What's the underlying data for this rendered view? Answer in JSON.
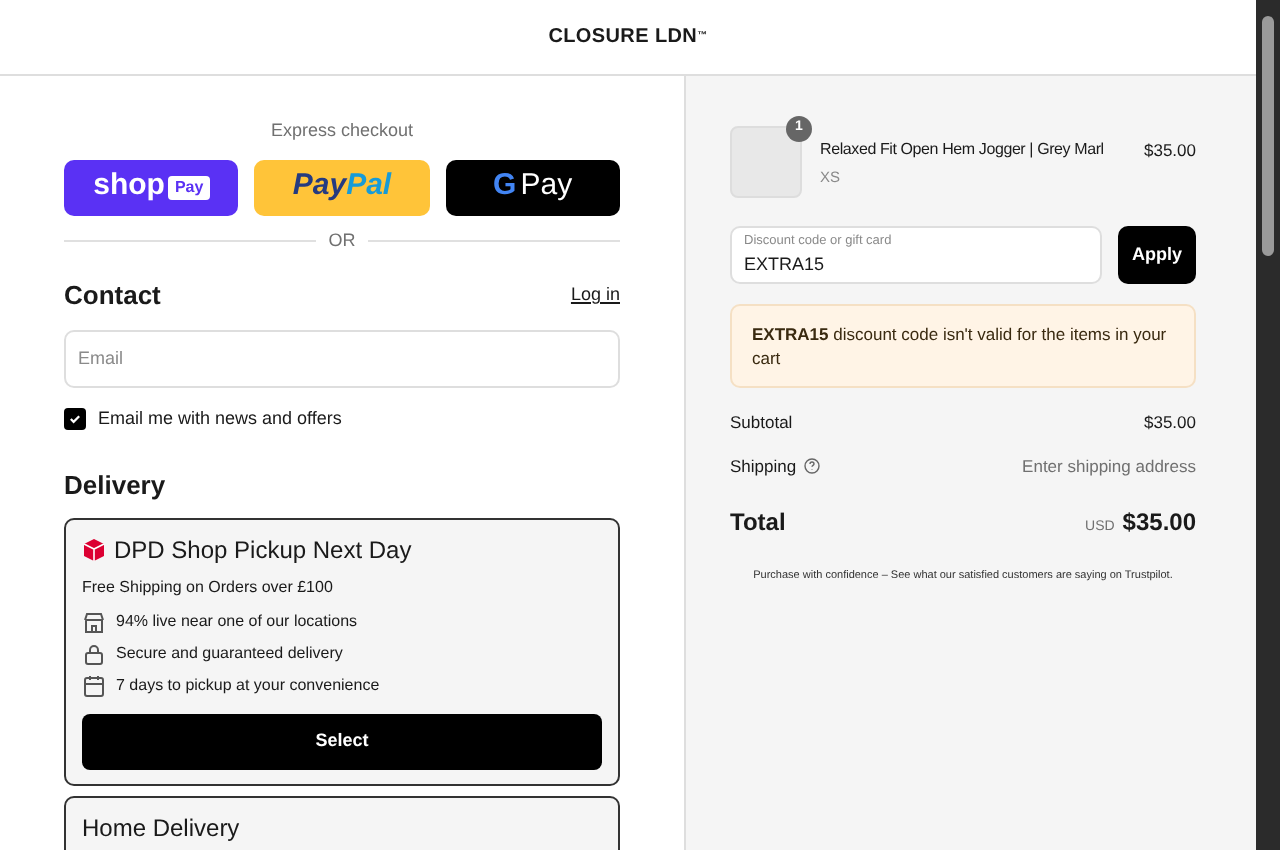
{
  "header": {
    "brand": "CLOSURE LDN",
    "brand_mark": "™"
  },
  "express": {
    "title": "Express checkout",
    "buttons": [
      {
        "kind": "shop",
        "label": "shop",
        "badge": "Pay"
      },
      {
        "kind": "paypal",
        "label": "Pay",
        "label_2": "Pal"
      },
      {
        "kind": "gpay",
        "letter": "G",
        "label": "Pay"
      }
    ],
    "divider": "OR"
  },
  "contact": {
    "title": "Contact",
    "login": "Log in",
    "email": {
      "placeholder": "Email"
    },
    "newsletter": {
      "label": "Email me with news and offers",
      "checked": true
    }
  },
  "delivery": {
    "title": "Delivery",
    "options": [
      {
        "name": "DPD Shop Pickup Next Day",
        "note": "Free Shipping on Orders over £100",
        "features": [
          {
            "kind": "store",
            "text": "94% live near one of our locations"
          },
          {
            "kind": "lock",
            "text": "Secure and guaranteed delivery"
          },
          {
            "kind": "calendar",
            "text": "7 days to pickup at your convenience"
          }
        ],
        "button": "Select"
      },
      {
        "name": "Home Delivery"
      }
    ]
  },
  "summary": {
    "item": {
      "name": "Relaxed Fit Open Hem Jogger | Grey Marl",
      "variant": "XS",
      "price": "$35.00",
      "quantity": "1"
    },
    "discount": {
      "label": "Discount code or gift card",
      "value": "EXTRA15",
      "button": "Apply"
    },
    "error": "**EXTRA15** discount code isn't valid for the items in your cart",
    "rows": [
      {
        "label": "Subtotal",
        "value": "$35.00",
        "help": false
      },
      {
        "label": "Shipping",
        "value": "Enter shipping address",
        "help": true
      }
    ],
    "total": {
      "label": "Total",
      "currency": "USD",
      "value": "$35.00"
    },
    "footer": "Purchase with confidence – See what our satisfied customers are saying on Trustpilot."
  }
}
